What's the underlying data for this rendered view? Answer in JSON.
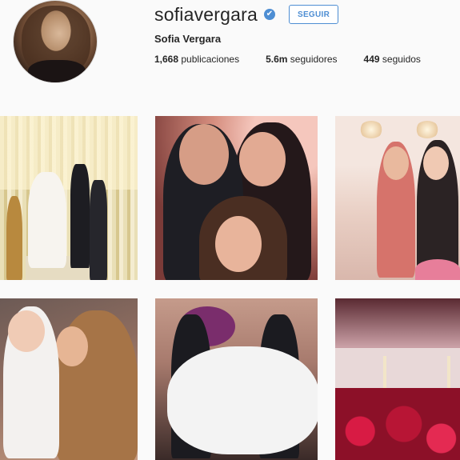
{
  "profile": {
    "username": "sofiavergara",
    "verified_glyph": "✔",
    "follow_label": "SEGUIR",
    "full_name": "Sofia Vergara",
    "stats": {
      "posts_count": "1,668",
      "posts_label": "publicaciones",
      "followers_count": "5.6m",
      "followers_label": "seguidores",
      "following_count": "449",
      "following_label": "seguidos"
    }
  },
  "colors": {
    "accent": "#4e8ed3",
    "background": "#fafafa",
    "text": "#262626"
  },
  "icons": {
    "verified": "verified-badge-icon"
  }
}
